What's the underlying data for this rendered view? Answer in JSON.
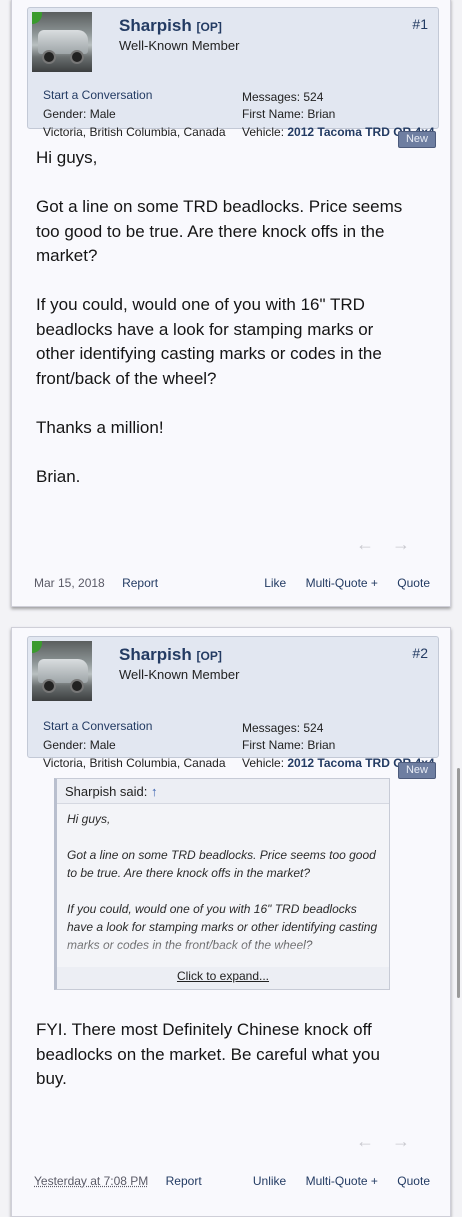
{
  "posts": [
    {
      "username": "Sharpish",
      "op_tag": "[OP]",
      "user_title": "Well-Known Member",
      "post_number": "#1",
      "start_conversation": "Start a Conversation",
      "messages": "Messages: 524",
      "gender": "Gender: Male",
      "first_name": "First Name: Brian",
      "location": "Victoria, British Columbia, Canada",
      "vehicle_label": "Vehicle:",
      "vehicle_value": "2012 Tacoma TRD OR 4x4",
      "new_badge": "New",
      "paragraphs": [
        "Hi guys,",
        "Got a line on some TRD beadlocks. Price seems too good to be true. Are there knock offs in the market?",
        "If you could, would one of you with 16\" TRD beadlocks have a look for stamping marks or other identifying casting marks or codes in the front/back of the wheel?",
        "Thanks a million!",
        "Brian."
      ],
      "date": "Mar 15, 2018",
      "report": "Report",
      "like": "Like",
      "multi_quote": "Multi-Quote +",
      "quote": "Quote"
    },
    {
      "username": "Sharpish",
      "op_tag": "[OP]",
      "user_title": "Well-Known Member",
      "post_number": "#2",
      "start_conversation": "Start a Conversation",
      "messages": "Messages: 524",
      "gender": "Gender: Male",
      "first_name": "First Name: Brian",
      "location": "Victoria, British Columbia, Canada",
      "vehicle_label": "Vehicle:",
      "vehicle_value": "2012 Tacoma TRD OR 4x4",
      "new_badge": "New",
      "quote_author": "Sharpish said:",
      "quote_paragraphs": [
        "Hi guys,",
        "Got a line on some TRD beadlocks. Price seems too good to be true. Are there knock offs in the market?",
        "If you could, would one of you with 16\" TRD beadlocks have a look for stamping marks or other identifying casting marks or codes in the front/back of the wheel?"
      ],
      "click_to_expand": "Click to expand...",
      "paragraphs": [
        "FYI. There most Definitely Chinese knock off beadlocks on the market. Be careful what you buy."
      ],
      "date": "Yesterday at 7:08 PM",
      "report": "Report",
      "like": "Unlike",
      "multi_quote": "Multi-Quote +",
      "quote": "Quote"
    }
  ],
  "icons": {
    "prev": "←",
    "next": "→",
    "jump_up": "↑"
  }
}
